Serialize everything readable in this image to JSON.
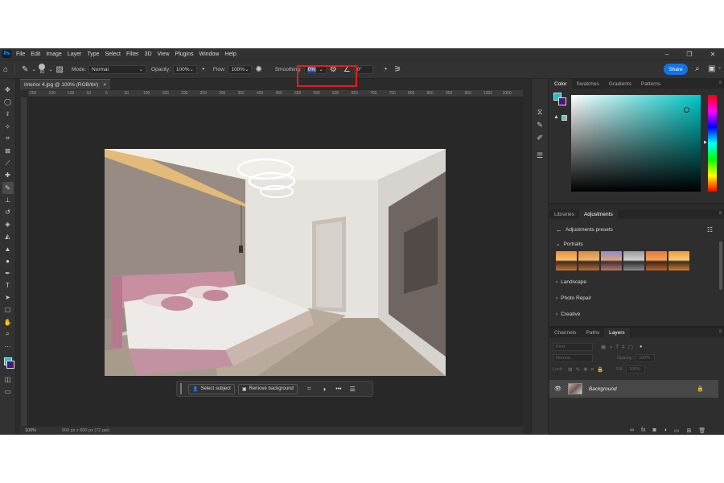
{
  "app": {
    "logo": "Ps"
  },
  "menu": [
    "File",
    "Edit",
    "Image",
    "Layer",
    "Type",
    "Select",
    "Filter",
    "3D",
    "View",
    "Plugins",
    "Window",
    "Help"
  ],
  "options": {
    "brush_size": "80",
    "mode_label": "Mode:",
    "mode_value": "Normal",
    "opacity_label": "Opacity:",
    "opacity_value": "100%",
    "flow_label": "Flow:",
    "flow_value": "100%",
    "smoothing_label": "Smoothing:",
    "smoothing_value": "0%",
    "angle_value": "0°",
    "share_label": "Share"
  },
  "document": {
    "tab_title": "Interior 4.jpg @ 100% (RGB/8#)",
    "tab_close": "×",
    "zoom": "100%",
    "dimensions": "900 px x 600 px (72 ppi)",
    "ruler_marks": [
      "200",
      "150",
      "100",
      "50",
      "0",
      "50",
      "100",
      "150",
      "200",
      "250",
      "300",
      "350",
      "400",
      "450",
      "500",
      "550",
      "600",
      "650",
      "700",
      "750",
      "800",
      "850",
      "900",
      "950",
      "1000",
      "1050"
    ]
  },
  "context_bar": {
    "select_subject": "Select subject",
    "remove_background": "Remove background",
    "more": "•••"
  },
  "color_panel": {
    "tabs": [
      "Color",
      "Swatches",
      "Gradients",
      "Patterns"
    ],
    "foreground": "#21bfbf",
    "background": "#4a1575"
  },
  "adjustments_panel": {
    "tabs": [
      "Libraries",
      "Adjustments"
    ],
    "header": "Adjustments presets",
    "groups": [
      "Portraits",
      "Landscape",
      "Photo Repair",
      "Creative"
    ]
  },
  "layers_panel": {
    "tabs": [
      "Channels",
      "Paths",
      "Layers"
    ],
    "kind": "Kind",
    "blend_mode": "Normal",
    "opacity_label": "Opacity:",
    "opacity_value": "100%",
    "lock_label": "Lock:",
    "fill_label": "Fill:",
    "fill_value": "100%",
    "layer_name": "Background"
  },
  "icons": {
    "move": "move-icon",
    "marquee": "marquee-icon",
    "lasso": "lasso-icon",
    "wand": "magic-wand-icon",
    "crop": "crop-icon",
    "frame": "frame-icon",
    "eyedropper": "eyedropper-icon",
    "heal": "healing-icon",
    "brush": "brush-icon",
    "stamp": "clone-stamp-icon",
    "history": "history-brush-icon",
    "eraser": "eraser-icon",
    "bucket": "paint-bucket-icon",
    "blur": "blur-icon",
    "dodge": "dodge-icon",
    "pen": "pen-icon",
    "type": "type-icon",
    "path": "path-select-icon",
    "shape": "shape-icon",
    "hand": "hand-icon",
    "zoom": "zoom-icon"
  }
}
